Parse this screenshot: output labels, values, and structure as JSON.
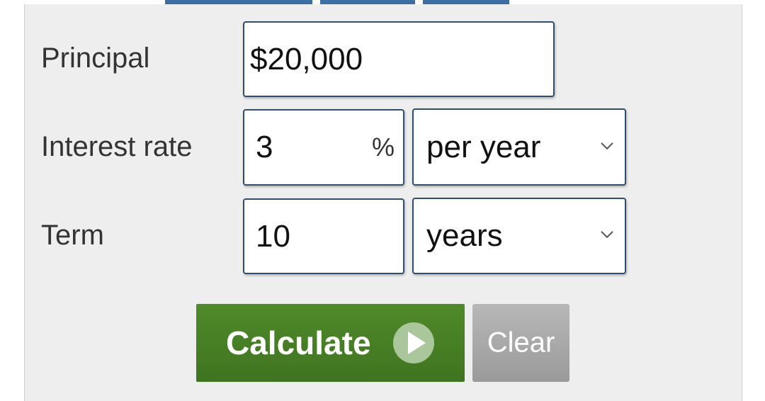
{
  "form": {
    "principal_label": "Principal",
    "principal_value": "$20,000",
    "rate_label": "Interest rate",
    "rate_value": "3",
    "rate_unit": "%",
    "rate_period": "per year",
    "term_label": "Term",
    "term_value": "10",
    "term_unit": "years"
  },
  "buttons": {
    "calculate_label": "Calculate",
    "clear_label": "Clear"
  },
  "icons": {
    "calculate": "play-icon",
    "dropdown": "chevron-down-icon"
  },
  "colors": {
    "calculate_bg": "#4f8a2a",
    "clear_bg": "#a8a8a8",
    "tab_blue": "#3a6ea5",
    "field_border": "#2f4f6f"
  }
}
